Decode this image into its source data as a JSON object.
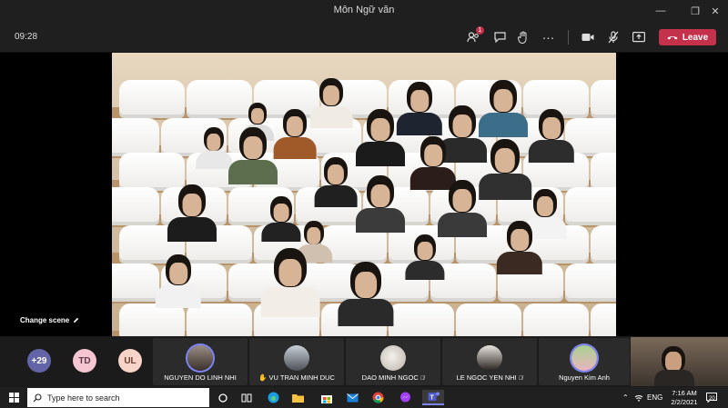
{
  "window": {
    "title": "Môn Ngữ văn",
    "minimize": "—",
    "restore": "❐",
    "close": "✕"
  },
  "toolbar": {
    "timer": "09:28",
    "participants_badge": "1",
    "leave_label": "Leave"
  },
  "scene": {
    "change_scene_label": "Change scene"
  },
  "participants": {
    "overflow_count": "+29",
    "initials": [
      {
        "text": "TD",
        "color": "#f3c6d2"
      },
      {
        "text": "UL",
        "color": "#f7d4c8"
      }
    ],
    "tiles": [
      {
        "name": "NGUYEN DO LINH NHI",
        "hand": "",
        "muted": ""
      },
      {
        "name": "VU TRAN MINH DUC",
        "hand": "✋",
        "muted": ""
      },
      {
        "name": "DAO MINH NGOC",
        "hand": "",
        "muted": "🎙̸"
      },
      {
        "name": "LE NGOC YEN NHI",
        "hand": "",
        "muted": "🎙̸"
      },
      {
        "name": "Nguyen Kim Anh",
        "hand": "",
        "muted": ""
      }
    ]
  },
  "taskbar": {
    "search_placeholder": "Type here to search",
    "language": "ENG",
    "time": "7:16 AM",
    "date": "2/2/2021",
    "notifications": "20"
  },
  "colors": {
    "accent": "#7f85f5",
    "leave": "#c4314b",
    "overflow_avatar": "#6264a7"
  }
}
